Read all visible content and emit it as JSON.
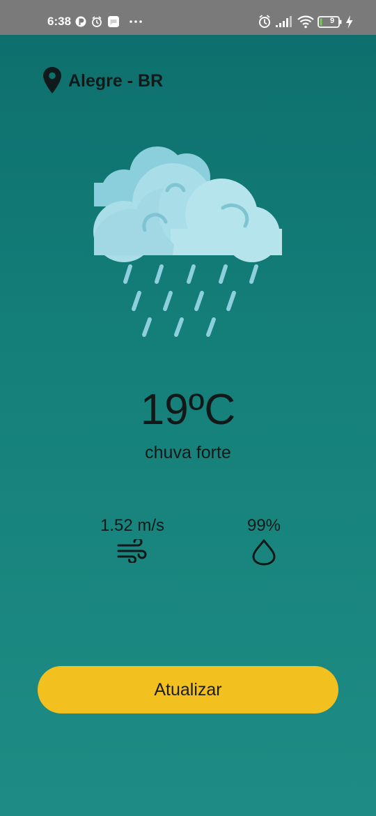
{
  "status_bar": {
    "time": "6:38",
    "battery_level": "9",
    "icons_left": [
      "notification-app-icon",
      "alarm-icon",
      "message-app-icon",
      "more-dots-icon"
    ],
    "icons_right": [
      "alarm-icon",
      "signal-icon",
      "wifi-icon",
      "battery-icon",
      "charging-icon"
    ]
  },
  "location": {
    "name": "Alegre - BR",
    "icon": "location-pin-icon"
  },
  "weather": {
    "illustration": "heavy-rain-cloud-illustration",
    "temperature": "19ºC",
    "description": "chuva forte"
  },
  "metrics": {
    "wind": {
      "value": "1.52 m/s",
      "icon": "wind-icon"
    },
    "humidity": {
      "value": "99%",
      "icon": "water-drop-icon"
    }
  },
  "actions": {
    "refresh_label": "Atualizar"
  },
  "colors": {
    "background_top": "#0d6e6c",
    "background_bottom": "#1e8c84",
    "status_bar": "#7a7a7a",
    "button": "#f2c11f",
    "text": "#121818",
    "cloud_light": "#b5e4ec",
    "cloud_dark": "#8ccfdc",
    "rain": "#8dcfdc"
  }
}
